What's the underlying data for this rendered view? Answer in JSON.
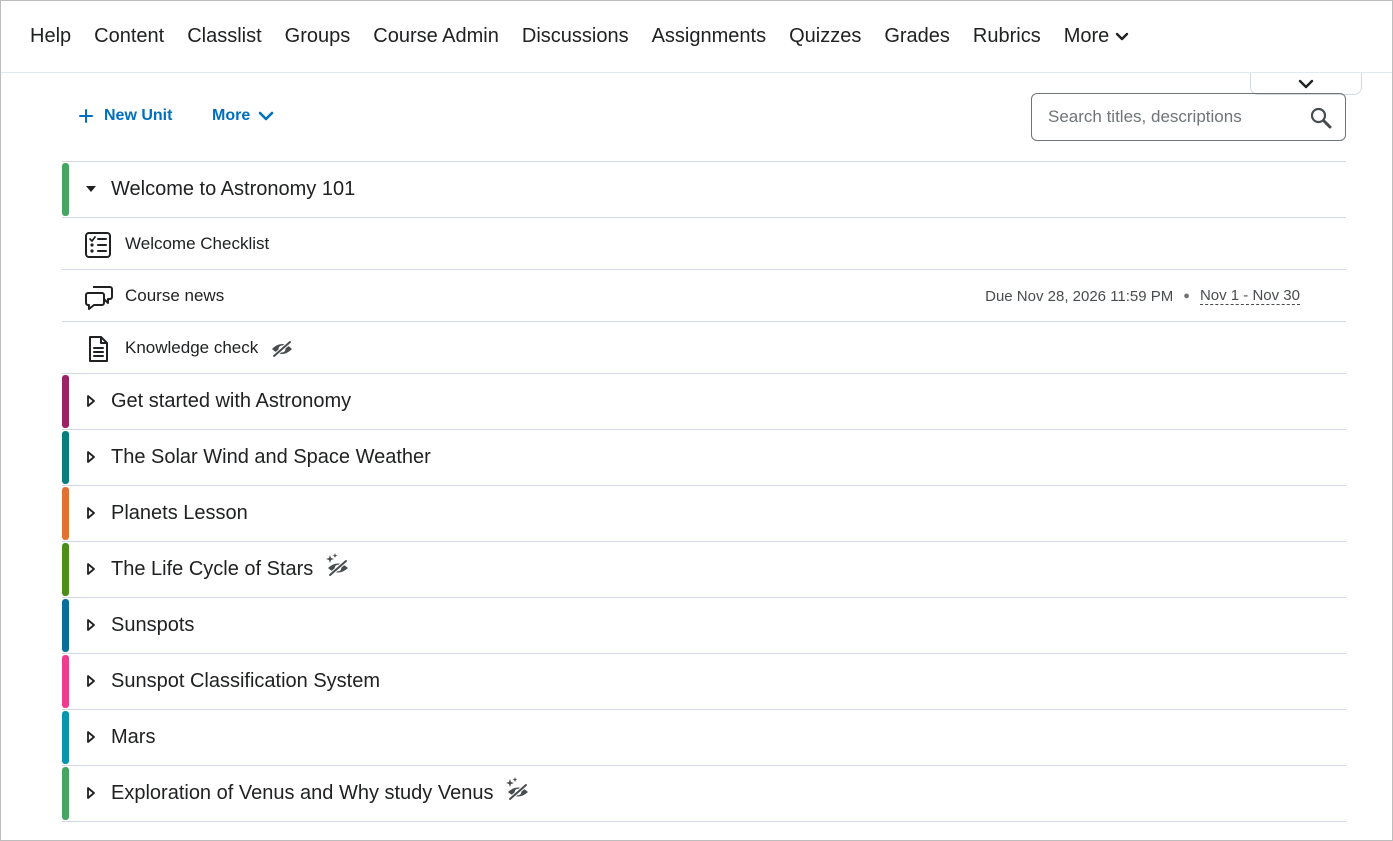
{
  "nav": {
    "items": [
      "Help",
      "Content",
      "Classlist",
      "Groups",
      "Course Admin",
      "Discussions",
      "Assignments",
      "Quizzes",
      "Grades",
      "Rubrics"
    ],
    "more_label": "More"
  },
  "toolbar": {
    "new_unit_label": "New Unit",
    "more_label": "More"
  },
  "search": {
    "placeholder": "Search titles, descriptions"
  },
  "units": [
    {
      "title": "Welcome to Astronomy 101",
      "color": "#46a661",
      "expanded": true
    },
    {
      "title": "Get started with Astronomy",
      "color": "#9b2265",
      "expanded": false
    },
    {
      "title": "The Solar Wind and Space Weather",
      "color": "#0a7d7e",
      "expanded": false
    },
    {
      "title": "Planets Lesson",
      "color": "#e07333",
      "expanded": false
    },
    {
      "title": "The Life Cycle of Stars",
      "color": "#4d8d1a",
      "expanded": false,
      "ai_hidden": true
    },
    {
      "title": "Sunspots",
      "color": "#0a6e9b",
      "expanded": false
    },
    {
      "title": "Sunspot Classification System",
      "color": "#ee3d8f",
      "expanded": false
    },
    {
      "title": "Mars",
      "color": "#0a95ad",
      "expanded": false
    },
    {
      "title": "Exploration of Venus and Why study Venus",
      "color": "#46a661",
      "expanded": false,
      "ai_hidden": true
    }
  ],
  "topics": [
    {
      "name": "Welcome Checklist",
      "icon": "checklist-icon"
    },
    {
      "name": "Course news",
      "icon": "discussion-icon",
      "due": "Due Nov 28, 2026 11:59 PM",
      "dates": "Nov 1 - Nov 30"
    },
    {
      "name": "Knowledge check",
      "icon": "document-icon",
      "hidden": true
    }
  ]
}
